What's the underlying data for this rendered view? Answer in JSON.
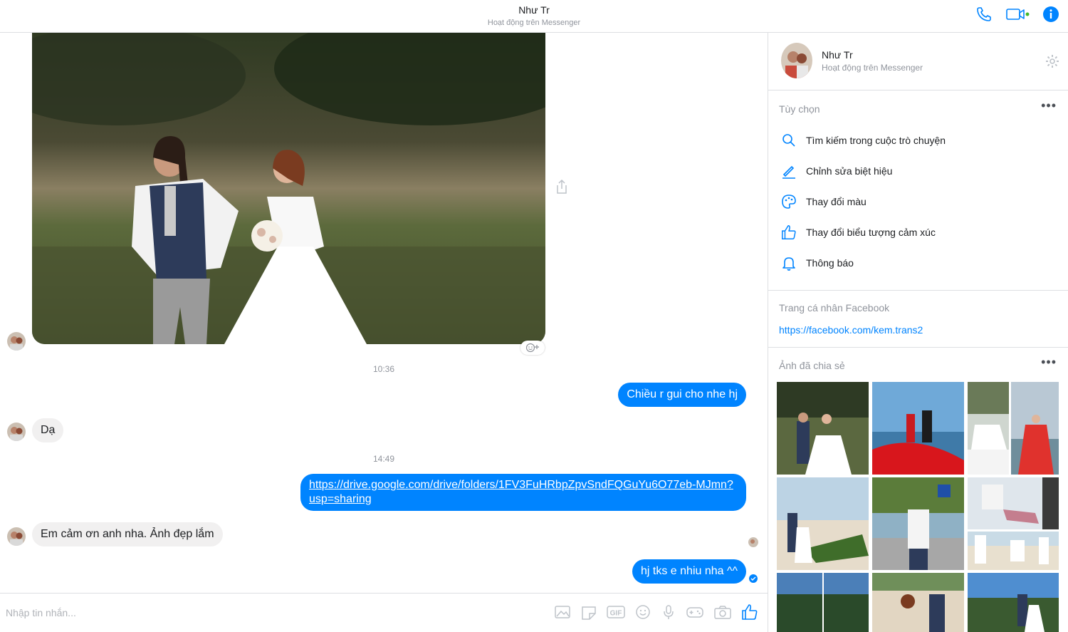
{
  "header": {
    "name": "Như Tr",
    "status": "Hoạt động trên Messenger"
  },
  "colors": {
    "accent": "#0084ff",
    "online": "#42b72a"
  },
  "messages": {
    "time1": "10:36",
    "out1": "Chiều r gui cho nhe hj",
    "in1": "Dạ",
    "time2": "14:49",
    "out2_link": "https://drive.google.com/drive/folders/1FV3FuHRbpZpvSndFQGuYu6O77eb-MJmn?usp=sharing",
    "in2": "Em cảm ơn anh nha. Ảnh đẹp lắm",
    "out3": "hj tks e nhiu nha ^^"
  },
  "composer": {
    "placeholder": "Nhập tin nhắn..."
  },
  "sidebar": {
    "name": "Như Tr",
    "status": "Hoạt động trên Messenger",
    "options_title": "Tùy chọn",
    "options": [
      {
        "label": "Tìm kiếm trong cuộc trò chuyện",
        "icon": "search-icon"
      },
      {
        "label": "Chỉnh sửa biệt hiệu",
        "icon": "pencil-icon"
      },
      {
        "label": "Thay đổi màu",
        "icon": "palette-icon"
      },
      {
        "label": "Thay đổi biểu tượng cảm xúc",
        "icon": "thumbs-up-icon"
      },
      {
        "label": "Thông báo",
        "icon": "bell-icon"
      }
    ],
    "profile_title": "Trang cá nhân Facebook",
    "profile_link": "https://facebook.com/kem.trans2",
    "shared_title": "Ảnh đã chia sẻ"
  }
}
